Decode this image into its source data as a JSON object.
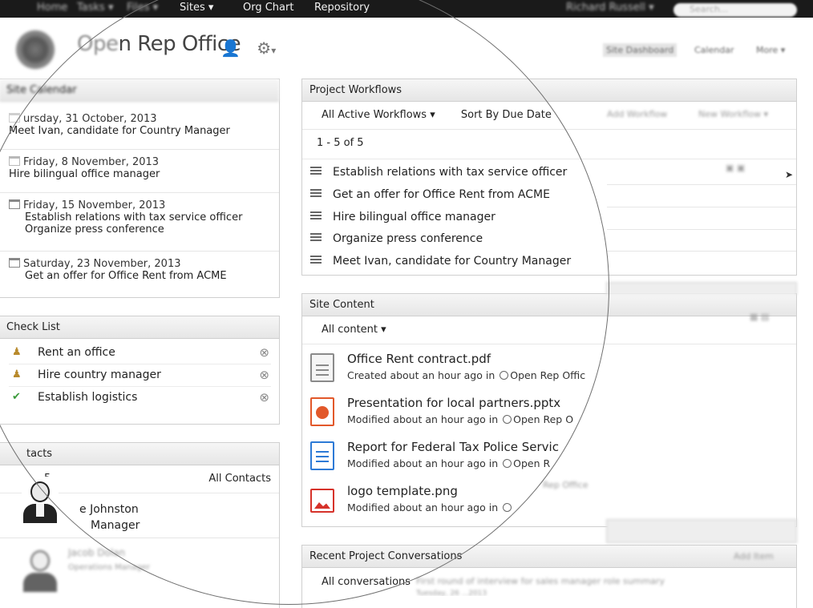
{
  "topnav": {
    "home": "Home",
    "tasks": "Tasks ▾",
    "files": "Files ▾",
    "sites": "Sites ▾",
    "org_chart": "Org Chart",
    "repository": "Repository",
    "user": "Richard Russell ▾",
    "search_placeholder": "Search..."
  },
  "site": {
    "title_visible": "n Rep Office",
    "title_blurred": "Ope",
    "header_right": {
      "dashboard": "Site Dashboard",
      "calendar": "Calendar",
      "more": "More ▾"
    }
  },
  "calendar": {
    "title": "Site Calendar",
    "entries": [
      {
        "date": "ursday, 31 October, 2013",
        "events": [
          "Meet Ivan, candidate for Country Manager"
        ]
      },
      {
        "date": "Friday, 8 November, 2013",
        "events": [
          "Hire bilingual office manager"
        ]
      },
      {
        "date": "Friday, 15 November, 2013",
        "events": [
          "Establish relations with tax service officer",
          "Organize press conference"
        ]
      },
      {
        "date": "Saturday, 23 November, 2013",
        "events": [
          "Get an offer for Office Rent from ACME"
        ]
      }
    ]
  },
  "workflows": {
    "title": "Project Workflows",
    "filter": "All Active Workflows ▾",
    "sort": "Sort By Due Date",
    "add": "Add Workflow",
    "new": "New Workflow ▾",
    "count": "1 - 5 of 5",
    "items": [
      "Establish relations with tax service officer",
      "Get an offer for Office Rent from ACME",
      "Hire bilingual office manager",
      "Organize press conference",
      "Meet Ivan, candidate for Country Manager"
    ]
  },
  "checklist": {
    "title": "Check List",
    "items": [
      {
        "label": "Rent an office",
        "done": false
      },
      {
        "label": "Hire country manager",
        "done": false
      },
      {
        "label": "Establish logistics",
        "done": true
      }
    ]
  },
  "contacts": {
    "title": "tacts",
    "count": "5",
    "all": "All Contacts",
    "people": [
      {
        "name": "e Johnston",
        "role": "Manager"
      },
      {
        "name": "Jacob Dolan",
        "role": "Operations Manager"
      }
    ]
  },
  "content": {
    "title": "Site Content",
    "filter": "All content ▾",
    "docs": [
      {
        "name": "Office Rent contract.pdf",
        "meta": "Created about an hour ago in",
        "site": "Open Rep Offic",
        "type": "pdf",
        "color": "#8a8a8a"
      },
      {
        "name": "Presentation for local partners.pptx",
        "meta": "Modified about an hour ago in",
        "site": "Open Rep O",
        "type": "pptx",
        "color": "#e2582a"
      },
      {
        "name": "Report for Federal Tax Police Servic",
        "meta": "Modified about an hour ago in",
        "site": "Open R",
        "type": "doc",
        "color": "#2d7ad6"
      },
      {
        "name": "logo template.png",
        "meta": "Modified about an hour ago in",
        "site": "",
        "type": "png",
        "color": "#d6322a"
      }
    ],
    "blurred_site": "Rep Office"
  },
  "conversations": {
    "title": "Recent Project Conversations",
    "filter": "All conversations",
    "add": "Add Item",
    "topic": "First round of interview for sales manager role summary",
    "date": "Tuesday, 26 ...2013"
  }
}
